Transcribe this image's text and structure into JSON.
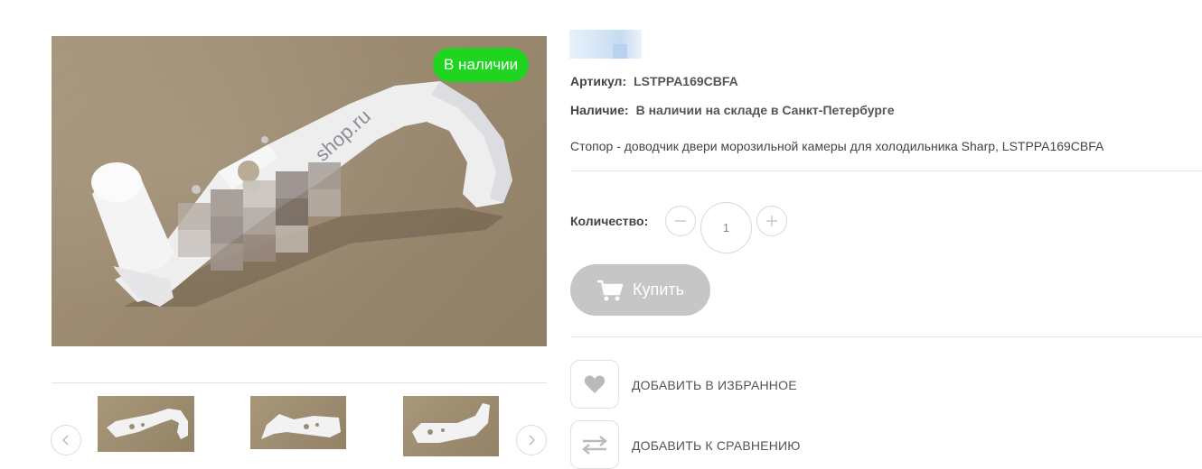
{
  "product": {
    "badge": "В наличии",
    "sku_label": "Артикул:",
    "sku": "LSTPPA169CBFA",
    "availability_label": "Наличие:",
    "availability": "В наличии на складе в Санкт-Петербурге",
    "description": "Стопор - доводчик двери морозильной камеры для холодильника Sharp, LSTPPA169CBFA",
    "watermark": "shop.ru"
  },
  "quantity": {
    "label": "Количество:",
    "value": "1"
  },
  "buy": {
    "label": "Купить"
  },
  "actions": {
    "favorite": "ДОБАВИТЬ В ИЗБРАННОЕ",
    "compare": "ДОБАВИТЬ К СРАВНЕНИЮ"
  },
  "colors": {
    "badge": "#1fd51f",
    "buy_button_disabled": "#c6c6c6",
    "background": "#ffffff"
  },
  "icons": {
    "prev": "chevron-left-icon",
    "next": "chevron-right-icon",
    "minus": "minus-icon",
    "plus": "plus-icon",
    "cart": "cart-icon",
    "favorite": "heart-icon",
    "compare": "compare-arrows-icon"
  }
}
